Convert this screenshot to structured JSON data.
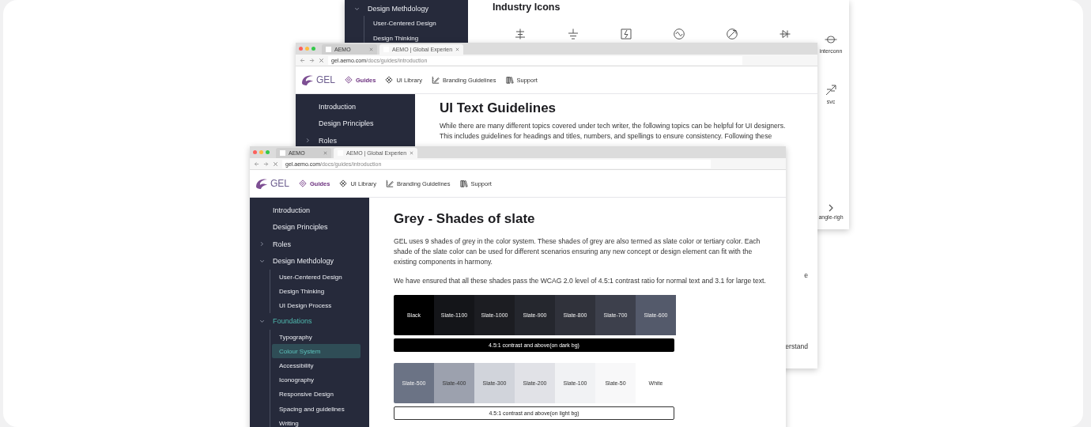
{
  "back_window": {
    "sidebar": [
      {
        "label": "Design Methdology",
        "selected": false,
        "expanded": true,
        "children": [
          {
            "label": "User-Centered Design",
            "selected": false
          },
          {
            "label": "Design Thinking",
            "selected": false
          }
        ]
      }
    ],
    "heading": "Industry Icons",
    "icon_labels": [
      "interconn",
      "svc",
      "angle-righ"
    ]
  },
  "middle_window": {
    "tabs": [
      {
        "label": "AEMO",
        "selected": false
      },
      {
        "label": "AEMO | Global Experien",
        "selected": true
      }
    ],
    "url_host": "gel.aemo.com",
    "url_path": "/docs/guides/introduction",
    "logo": "GEL",
    "nav": [
      {
        "label": "Guides",
        "selected": true
      },
      {
        "label": "UI Library",
        "selected": false
      },
      {
        "label": "Branding Guidelines",
        "selected": false
      },
      {
        "label": "Support",
        "selected": false
      }
    ],
    "sidebar": [
      {
        "label": "Introduction",
        "selected": false
      },
      {
        "label": "Design Principles",
        "selected": false
      },
      {
        "label": "Roles",
        "selected": false,
        "expanded": false
      }
    ],
    "heading": "UI Text Guidelines",
    "paragraph_lines": [
      "While there are many different topics covered under tech writer, the following topics can be helpful for UI designers.",
      "This includes guidelines for headings and titles, numbers, and spellings to ensure consistency. Following these"
    ],
    "fragments": [
      "e",
      "erstand"
    ]
  },
  "front_window": {
    "tabs": [
      {
        "label": "AEMO",
        "selected": false
      },
      {
        "label": "AEMO | Global Experien",
        "selected": true
      }
    ],
    "url_host": "gel.aemo.com",
    "url_path": "/docs/guides/introduction",
    "logo": "GEL",
    "nav": [
      {
        "label": "Guides",
        "selected": true
      },
      {
        "label": "UI Library",
        "selected": false
      },
      {
        "label": "Branding Guidelines",
        "selected": false
      },
      {
        "label": "Support",
        "selected": false
      }
    ],
    "sidebar": [
      {
        "label": "Introduction",
        "selected": false
      },
      {
        "label": "Design Principles",
        "selected": false
      },
      {
        "label": "Roles",
        "selected": false,
        "expanded": false
      },
      {
        "label": "Design Methdology",
        "selected": false,
        "expanded": true,
        "children": [
          {
            "label": "User-Centered Design",
            "selected": false
          },
          {
            "label": "Design Thinking",
            "selected": false
          },
          {
            "label": "UI Design Process",
            "selected": false
          }
        ]
      },
      {
        "label": "Foundations",
        "selected": false,
        "expanded": true,
        "children": [
          {
            "label": "Typography",
            "selected": false
          },
          {
            "label": "Colour System",
            "selected": true
          },
          {
            "label": "Accessibility",
            "selected": false
          },
          {
            "label": "Iconography",
            "selected": false
          },
          {
            "label": "Responsive Design",
            "selected": false
          },
          {
            "label": "Spacing and guidelines",
            "selected": false
          },
          {
            "label": "Writing",
            "selected": false
          }
        ]
      }
    ],
    "heading": "Grey - Shades of slate",
    "paragraphs": [
      "GEL uses 9 shades of grey in the color system. These shades of grey are also termed as slate color or tertiary color. Each shade of the slate color can be used for different scenarios ensuring any new concept or design element can fit with the existing components in harmony.",
      "We have ensured that all these shades pass the WCAG 2.0 level of 4.5:1 contrast ratio for normal text and 3.1 for large text."
    ],
    "swatch_groups": [
      {
        "kind": "dark",
        "note": "4.5:1 contrast and above(on dark bg)",
        "swatches": [
          {
            "label": "Black",
            "color": "#000000"
          },
          {
            "label": "Slate-1100",
            "color": "#141519"
          },
          {
            "label": "Slate-1000",
            "color": "#1c1d22"
          },
          {
            "label": "Slate-900",
            "color": "#25272e"
          },
          {
            "label": "Slate-800",
            "color": "#30323b"
          },
          {
            "label": "Slate-700",
            "color": "#3d404c"
          },
          {
            "label": "Slate-600",
            "color": "#545a6b"
          }
        ]
      },
      {
        "kind": "light",
        "note": "4.5:1 contrast and above(on light bg)",
        "swatches": [
          {
            "label": "Slate-500",
            "color": "#6b7385"
          },
          {
            "label": "Slate-400",
            "color": "#9ca1ae"
          },
          {
            "label": "Slate-300",
            "color": "#d1d4db"
          },
          {
            "label": "Slate-200",
            "color": "#e1e2e7"
          },
          {
            "label": "Slate-100",
            "color": "#f1f2f4"
          },
          {
            "label": "Slate-50",
            "color": "#f8f8f9"
          },
          {
            "label": "White",
            "color": "#ffffff"
          }
        ]
      }
    ]
  }
}
